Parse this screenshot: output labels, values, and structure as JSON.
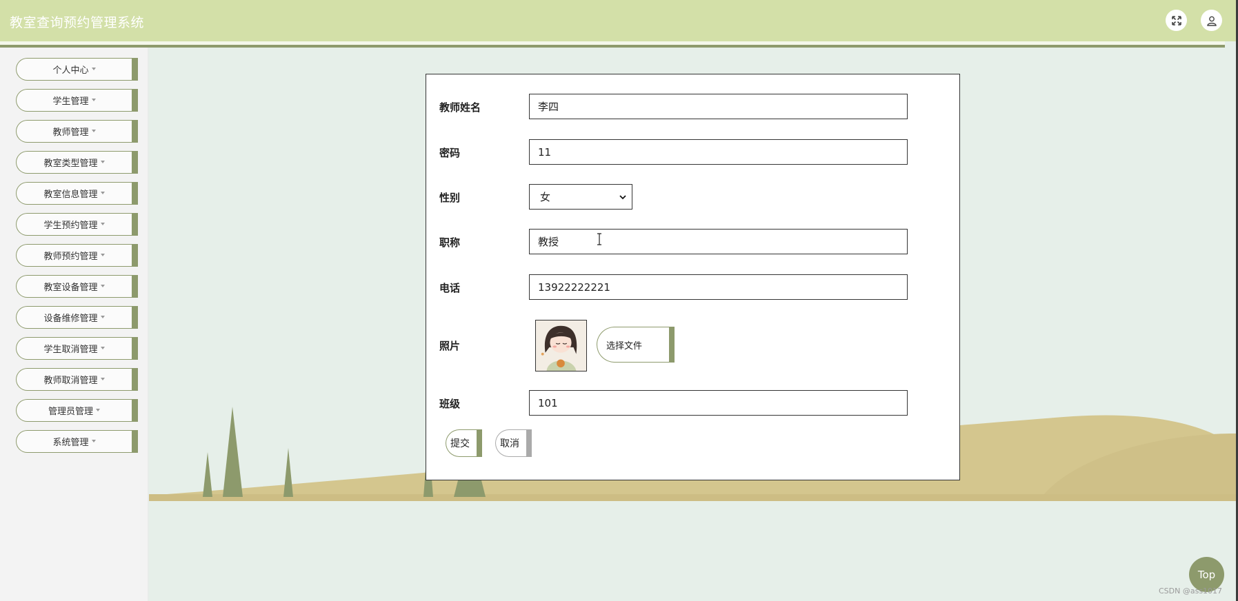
{
  "app": {
    "title": "教室查询预约管理系统"
  },
  "header": {
    "fullscreen_icon": "expand-icon",
    "user_icon": "user-icon"
  },
  "sidebar": {
    "items": [
      {
        "label": "个人中心"
      },
      {
        "label": "学生管理"
      },
      {
        "label": "教师管理"
      },
      {
        "label": "教室类型管理"
      },
      {
        "label": "教室信息管理"
      },
      {
        "label": "学生预约管理"
      },
      {
        "label": "教师预约管理"
      },
      {
        "label": "教室设备管理"
      },
      {
        "label": "设备维修管理"
      },
      {
        "label": "学生取消管理"
      },
      {
        "label": "教师取消管理"
      },
      {
        "label": "管理员管理"
      },
      {
        "label": "系统管理"
      }
    ]
  },
  "form": {
    "name_label": "教师姓名",
    "name_value": "李四",
    "password_label": "密码",
    "password_value": "11",
    "gender_label": "性别",
    "gender_value": "女",
    "title_label": "职称",
    "title_value": "教授",
    "phone_label": "电话",
    "phone_value": "13922222221",
    "photo_label": "照片",
    "file_button": "选择文件",
    "class_label": "班级",
    "class_value": "101",
    "submit_label": "提交",
    "cancel_label": "取消"
  },
  "colors": {
    "header_bg": "#d3e0a8",
    "accent": "#8d9a6c",
    "content_bg": "#e6efe9",
    "hill": "#d4c68e"
  },
  "footer": {
    "top_button": "Top",
    "watermark": "CSDN @ass1017"
  }
}
